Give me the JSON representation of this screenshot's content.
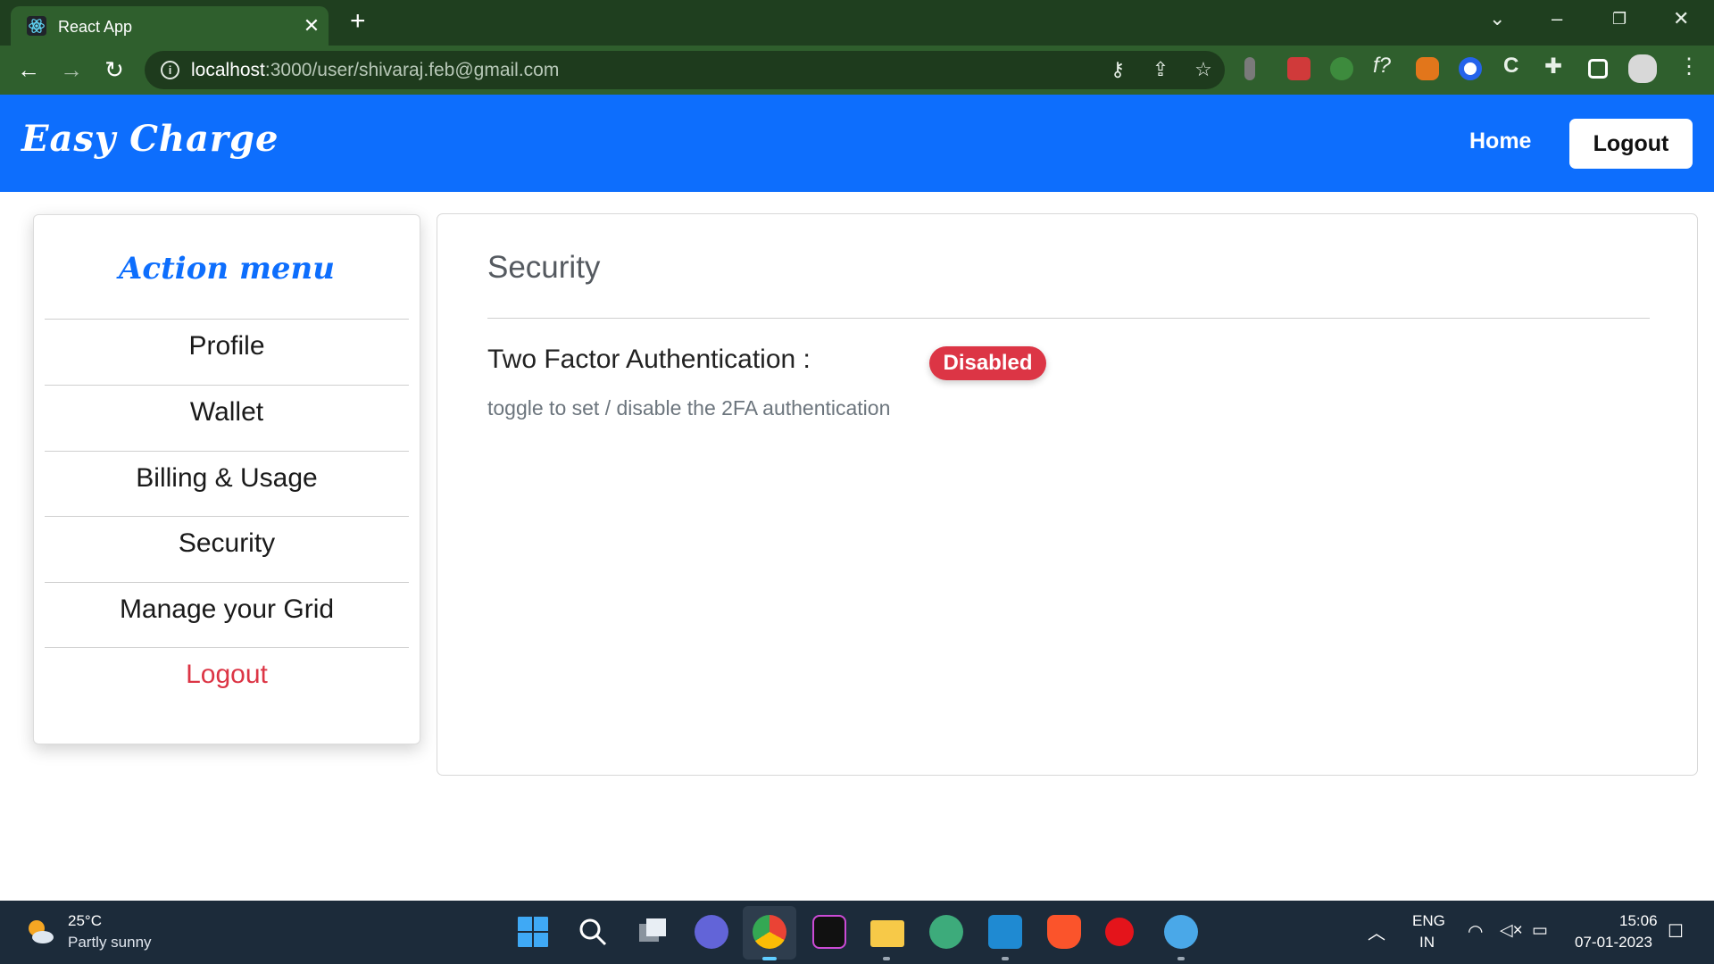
{
  "browser": {
    "tab_title": "React App",
    "url_host": "localhost",
    "url_path": ":3000/user/shivaraj.feb@gmail.com"
  },
  "navbar": {
    "brand": "Easy Charge",
    "home_label": "Home",
    "logout_label": "Logout"
  },
  "sidebar": {
    "title": "Action menu",
    "items": [
      {
        "label": "Profile"
      },
      {
        "label": "Wallet"
      },
      {
        "label": "Billing & Usage"
      },
      {
        "label": "Security"
      },
      {
        "label": "Manage your Grid"
      },
      {
        "label": "Logout"
      }
    ]
  },
  "main": {
    "title": "Security",
    "tfa_label": "Two Factor Authentication :",
    "tfa_status": "Disabled",
    "tfa_help": "toggle to set / disable the 2FA authentication"
  },
  "taskbar": {
    "weather_temp": "25°C",
    "weather_desc": "Partly sunny",
    "lang_top": "ENG",
    "lang_bottom": "IN",
    "time": "15:06",
    "date": "07-01-2023"
  },
  "colors": {
    "navbar": "#0d6efd",
    "danger": "#dc3545",
    "chrome": "#2f5f2d"
  }
}
